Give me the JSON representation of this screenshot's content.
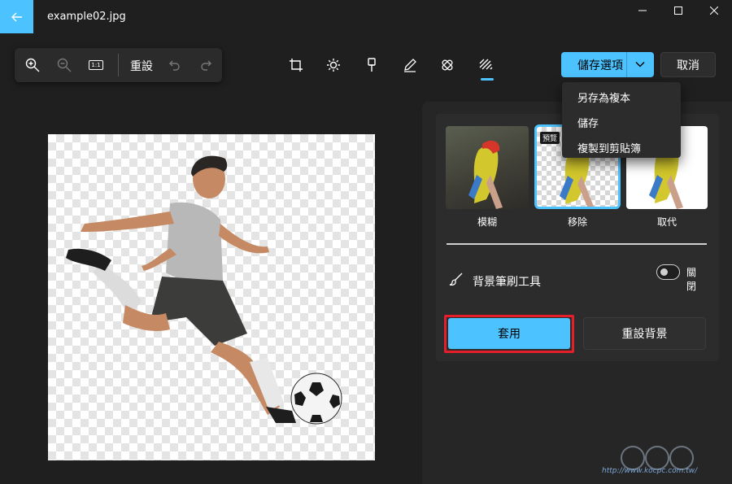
{
  "window": {
    "title": "example02.jpg"
  },
  "toolbar": {
    "reset_label": "重設",
    "zoom_actual_label": "1:1"
  },
  "save": {
    "button_label": "儲存選項",
    "cancel_label": "取消",
    "menu": [
      "另存為複本",
      "儲存",
      "複製到剪貼簿"
    ]
  },
  "background_panel": {
    "options": [
      {
        "label": "模糊"
      },
      {
        "label": "移除",
        "badge": "預覽",
        "selected": true
      },
      {
        "label": "取代"
      }
    ],
    "brush_tool_label": "背景筆刷工具",
    "toggle_state_label": "關閉",
    "toggle_on": false,
    "apply_label": "套用",
    "reset_background_label": "重設背景"
  },
  "watermark": {
    "text": "http://www.kocpc.com.tw/"
  },
  "colors": {
    "accent": "#4cc2ff",
    "background": "#1f1f1f",
    "panel": "#262626",
    "highlight_outline": "#e61e2a"
  },
  "icons": [
    "back-arrow-icon",
    "minimize-icon",
    "maximize-icon",
    "close-icon",
    "zoom-in-icon",
    "zoom-out-icon",
    "actual-size-icon",
    "undo-icon",
    "redo-icon",
    "crop-icon",
    "adjust-icon",
    "filter-icon",
    "markup-icon",
    "retouch-icon",
    "background-icon",
    "chevron-down-icon",
    "brush-icon"
  ]
}
